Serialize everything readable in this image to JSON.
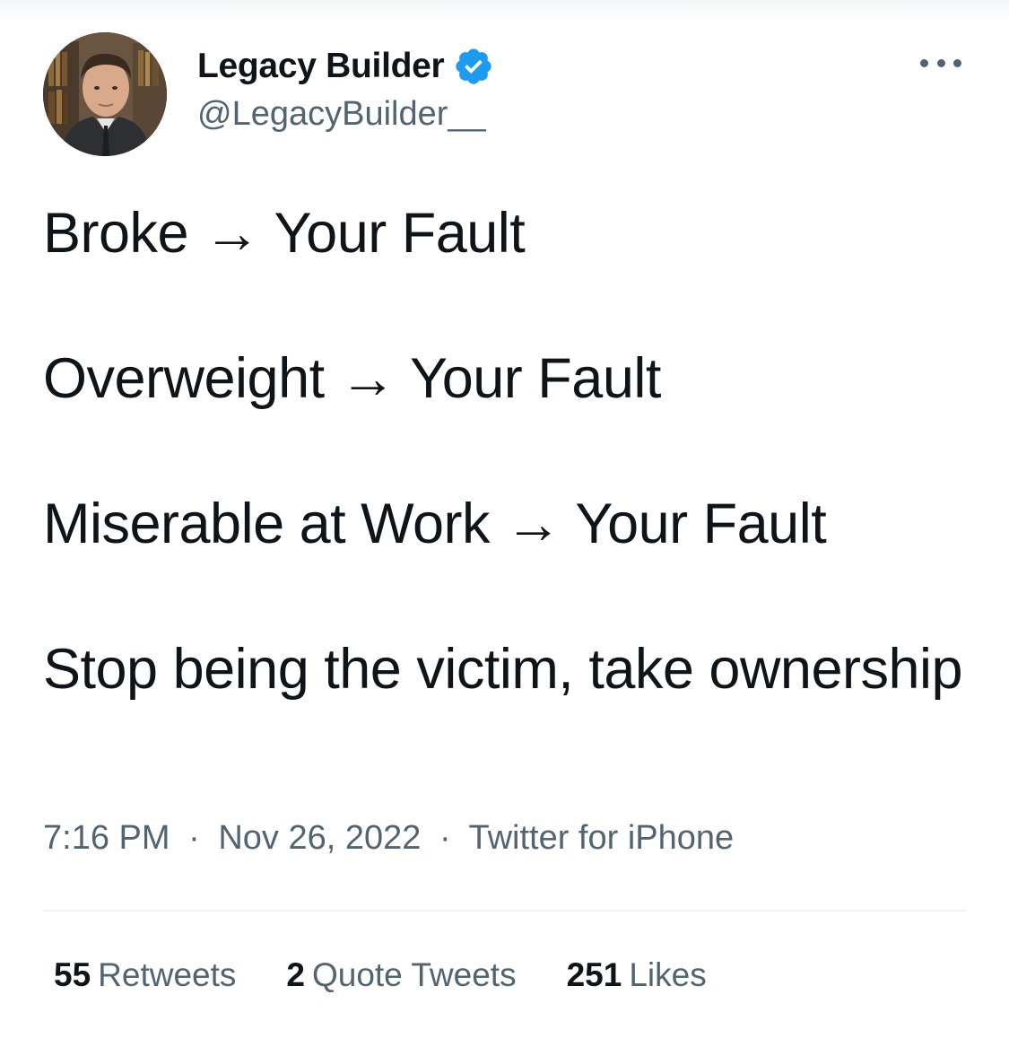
{
  "author": {
    "display_name": "Legacy Builder",
    "handle": "@LegacyBuilder__",
    "verified_icon": "verified-badge-icon",
    "avatar_icon": "profile-photo"
  },
  "more_icon": "more-options-icon",
  "tweet": {
    "lines": [
      "Broke → Your Fault",
      "Overweight → Your Fault",
      "Miserable at Work → Your Fault",
      "Stop being the victim, take ownership"
    ]
  },
  "meta": {
    "time": "7:16 PM",
    "separator": "·",
    "date": "Nov 26, 2022",
    "source": "Twitter for iPhone"
  },
  "stats": {
    "retweets": {
      "count": "55",
      "label": "Retweets"
    },
    "quote_tweets": {
      "count": "2",
      "label": "Quote Tweets"
    },
    "likes": {
      "count": "251",
      "label": "Likes"
    }
  },
  "colors": {
    "text": "#0f1419",
    "secondary": "#536471",
    "verified": "#1d9bf0",
    "divider": "#eff3f4"
  }
}
